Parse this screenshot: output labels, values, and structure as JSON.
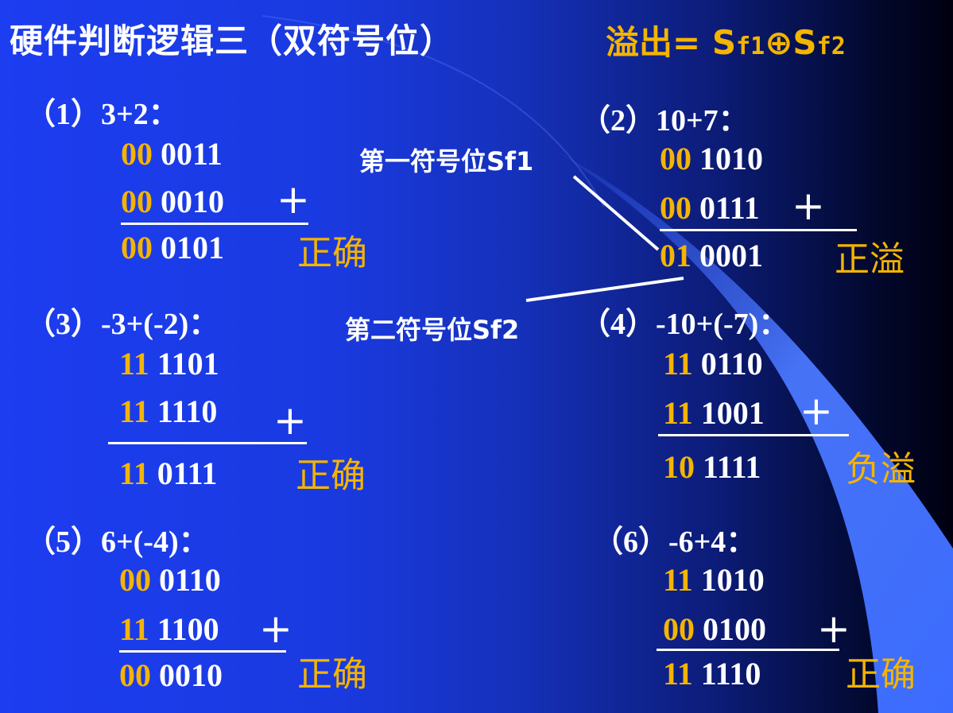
{
  "title": "硬件判断逻辑三（双符号位）",
  "formula": {
    "prefix": "溢出= ",
    "s1": "S",
    "f1": "f1",
    "op": "⊕",
    "s2": "S",
    "f2": "f2"
  },
  "annotations": {
    "sf1": "第一符号位Sf1",
    "sf2": "第二符号位Sf2"
  },
  "examples": [
    {
      "label": "（1）3+2：",
      "rows": [
        {
          "sign": "00",
          "bits": " 0011"
        },
        {
          "sign": "00",
          "bits": " 0010"
        },
        {
          "sign": "00",
          "bits": " 0101"
        }
      ],
      "plus": "+",
      "result": "正确"
    },
    {
      "label": "（2）10+7：",
      "rows": [
        {
          "sign": "00",
          "bits": " 1010"
        },
        {
          "sign": "00",
          "bits": " 0111"
        },
        {
          "sign": "01",
          "bits": " 0001"
        }
      ],
      "plus": "+",
      "result": "正溢"
    },
    {
      "label": "（3）-3+(-2)：",
      "rows": [
        {
          "sign": "11",
          "bits": " 1101"
        },
        {
          "sign": "11",
          "bits": " 1110"
        },
        {
          "sign": "11",
          "bits": " 0111"
        }
      ],
      "plus": "+",
      "result": "正确"
    },
    {
      "label": "（4）-10+(-7)：",
      "rows": [
        {
          "sign": "11",
          "bits": " 0110"
        },
        {
          "sign": "11",
          "bits": " 1001"
        },
        {
          "sign": "10",
          "bits": " 1111"
        }
      ],
      "plus": "+",
      "result": "负溢"
    },
    {
      "label": "（5）6+(-4)：",
      "rows": [
        {
          "sign": "00",
          "bits": " 0110"
        },
        {
          "sign": "11",
          "bits": " 1100"
        },
        {
          "sign": "00",
          "bits": " 0010"
        }
      ],
      "plus": "+",
      "result": "正确"
    },
    {
      "label": "（6）-6+4：",
      "rows": [
        {
          "sign": "11",
          "bits": " 1010"
        },
        {
          "sign": "00",
          "bits": " 0100"
        },
        {
          "sign": "11",
          "bits": " 1110"
        }
      ],
      "plus": "+",
      "result": "正确"
    }
  ],
  "colors": {
    "accent": "#f4b400",
    "background": "#1c3df0",
    "sweep": "#4a78ff"
  }
}
